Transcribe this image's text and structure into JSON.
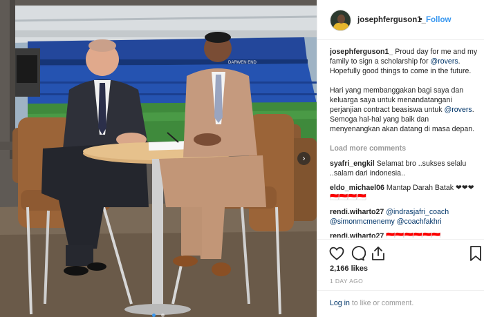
{
  "post": {
    "username": "josephferguson1_",
    "follow_label": "Follow",
    "more_label": "•••",
    "caption_en": "Proud day for me and my family to sign a scholarship for",
    "caption_mention": "@rovers",
    "caption_en_end": ". Hopefully good things to come in the future.",
    "caption_id": "Hari yang membanggakan bagi saya dan keluarga saya untuk menandatangani perjanjian contract beasiswa untuk",
    "caption_id_mention": "@rovers",
    "caption_id_end": ". Semoga hal-hal yang baik dan menyenangkan akan datang di masa depan.",
    "load_more": "Load more comments",
    "likes": "2,166 likes",
    "time_ago": "1 DAY AGO",
    "login_link": "Log in",
    "login_rest": " to like or comment."
  },
  "comments": [
    {
      "user": "syafri_engkil",
      "text": " Selamat bro ..sukses selalu ..salam dari indonesia..",
      "mentions": ""
    },
    {
      "user": "eldo_michael06",
      "text": " Mantap Darah Batak ❤❤❤ 🇮🇩🇮🇩🇮🇩🇮🇩",
      "mentions": ""
    },
    {
      "user": "rendi.wiharto27",
      "text": " ",
      "mentions": "@indrasjafri_coach @simonmcmenemy @coachfakhri"
    },
    {
      "user": "rendi.wiharto27",
      "text": " 🇮🇩🇮🇩🇮🇩🇮🇩🇮🇩🇮🇩",
      "mentions": ""
    }
  ],
  "photo": {
    "stadium_banner": "DARWEN END",
    "carousel_next": "›",
    "slides": 2,
    "active_slide": 1
  },
  "colors": {
    "link_blue": "#3897f0",
    "mention_blue": "#003569",
    "muted": "#999999",
    "seat_blue": "#1f4aa8"
  },
  "icons": [
    "heart-icon",
    "comment-icon",
    "share-icon",
    "bookmark-icon",
    "chevron-right-icon"
  ]
}
